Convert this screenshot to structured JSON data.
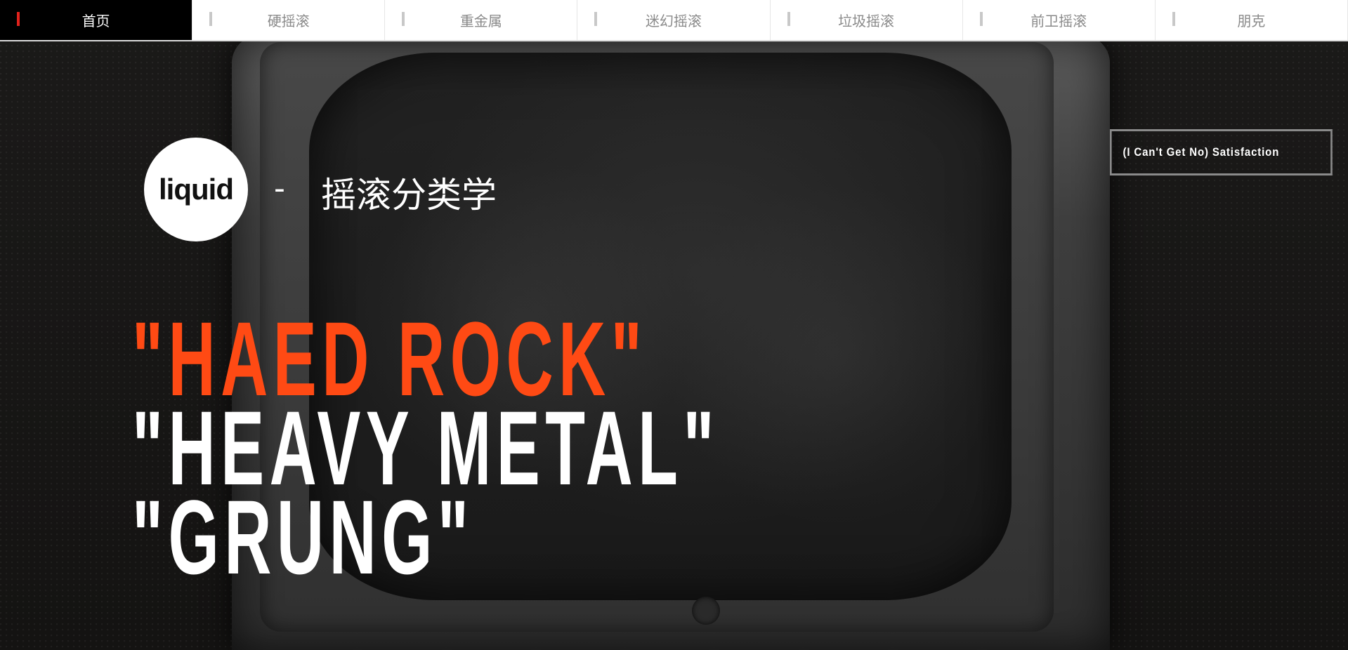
{
  "nav": {
    "items": [
      {
        "label": "首页",
        "active": true
      },
      {
        "label": "硬摇滚",
        "active": false
      },
      {
        "label": "重金属",
        "active": false
      },
      {
        "label": "迷幻摇滚",
        "active": false
      },
      {
        "label": "垃圾摇滚",
        "active": false
      },
      {
        "label": "前卫摇滚",
        "active": false
      },
      {
        "label": "朋克",
        "active": false
      }
    ]
  },
  "logo": {
    "text": "liquid"
  },
  "header": {
    "separator": "-",
    "subtitle": "摇滚分类学"
  },
  "song_button": {
    "label": "(I Can't Get No) Satisfaction"
  },
  "headline": {
    "lines": [
      "\"HAED ROCK\"",
      "\"HEAVY METAL\"",
      "\"GRUNG\""
    ]
  },
  "colors": {
    "accent_orange": "#ff4a14",
    "active_marker": "#e1221c",
    "nav_active_bg": "#000000"
  }
}
